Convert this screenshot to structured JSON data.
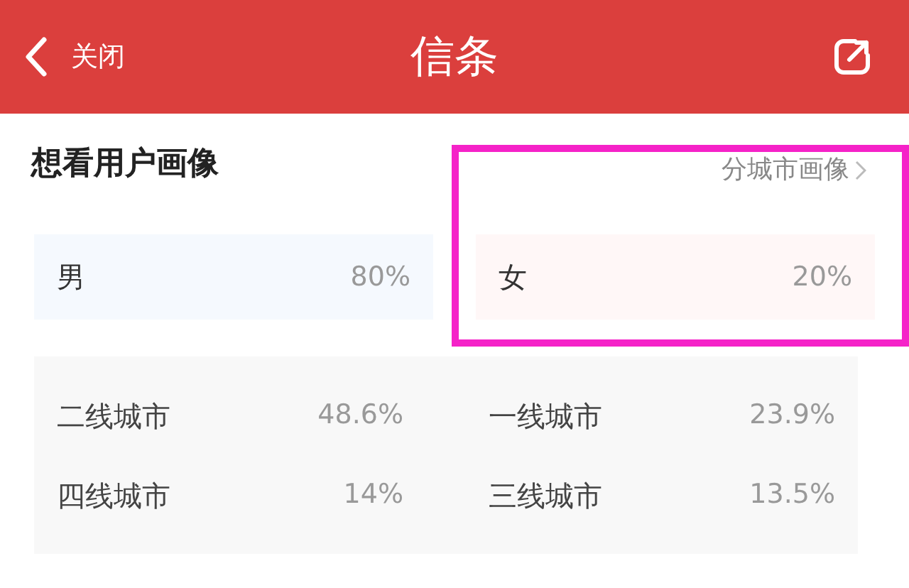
{
  "header": {
    "back_label": "关闭",
    "title": "信条"
  },
  "section": {
    "title": "想看用户画像",
    "link": "分城市画像"
  },
  "gender": [
    {
      "label": "男",
      "value": "80%",
      "color": "#f5f9fe"
    },
    {
      "label": "女",
      "value": "20%",
      "color": "#fff7f7"
    }
  ],
  "cities": [
    {
      "label": "二线城市",
      "value": "48.6%"
    },
    {
      "label": "一线城市",
      "value": "23.9%"
    },
    {
      "label": "四线城市",
      "value": "14%"
    },
    {
      "label": "三线城市",
      "value": "13.5%"
    }
  ]
}
